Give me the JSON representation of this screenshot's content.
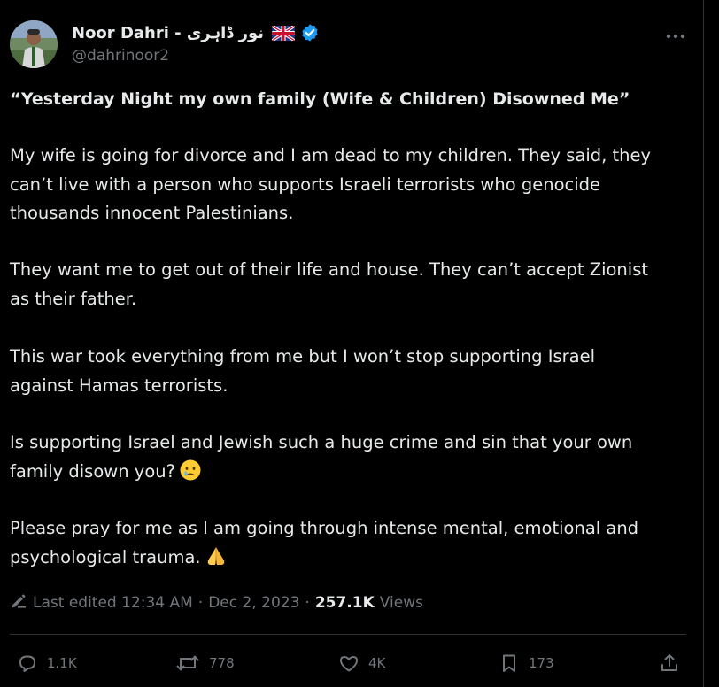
{
  "author": {
    "display_name": "Noor Dahri - نور ڈاہری",
    "handle": "@dahrinoor2"
  },
  "tweet": {
    "headline": "“Yesterday Night my own family (Wife & Children) Disowned Me”",
    "para1_line1": "My wife is going for divorce and I am dead to my children. They said, they",
    "para1_line2": "can’t live with a person who supports Israeli terrorists who genocide",
    "para1_line3": "thousands innocent Palestinians.",
    "para2_line1": "They want me to get out of their life and house. They can’t accept Zionist",
    "para2_line2": "as their father.",
    "para3_line1": "This war took everything from me but I won’t stop supporting Israel",
    "para3_line2": "against Hamas terrorists.",
    "para4_line1": "Is supporting Israel and Jewish such a huge crime and sin that your own",
    "para4_line2": "family disown you?",
    "para5_line1": "Please pray for me as I am going through intense mental, emotional and",
    "para5_line2": "psychological trauma."
  },
  "meta": {
    "edited": "Last edited 12:34 AM",
    "separator1": "·",
    "date": "Dec 2, 2023",
    "separator2": "·",
    "views_count": "257.1K",
    "views_label": "Views"
  },
  "actions": {
    "replies": "1.1K",
    "reposts": "778",
    "likes": "4K",
    "bookmarks": "173"
  },
  "icons": {
    "flag": "uk-flag-icon",
    "verified": "verified-badge-icon",
    "more": "more-dots-icon",
    "edit": "pencil-icon",
    "reply": "reply-icon",
    "repost": "repost-icon",
    "like": "heart-icon",
    "bookmark": "bookmark-icon",
    "share": "share-icon",
    "emoji_tear": "crying-face-emoji",
    "emoji_pray": "folded-hands-emoji"
  },
  "colors": {
    "background": "#000000",
    "text": "#e7e9ea",
    "muted": "#71767b",
    "verified": "#1d9bf0",
    "divider": "#2f3336"
  }
}
